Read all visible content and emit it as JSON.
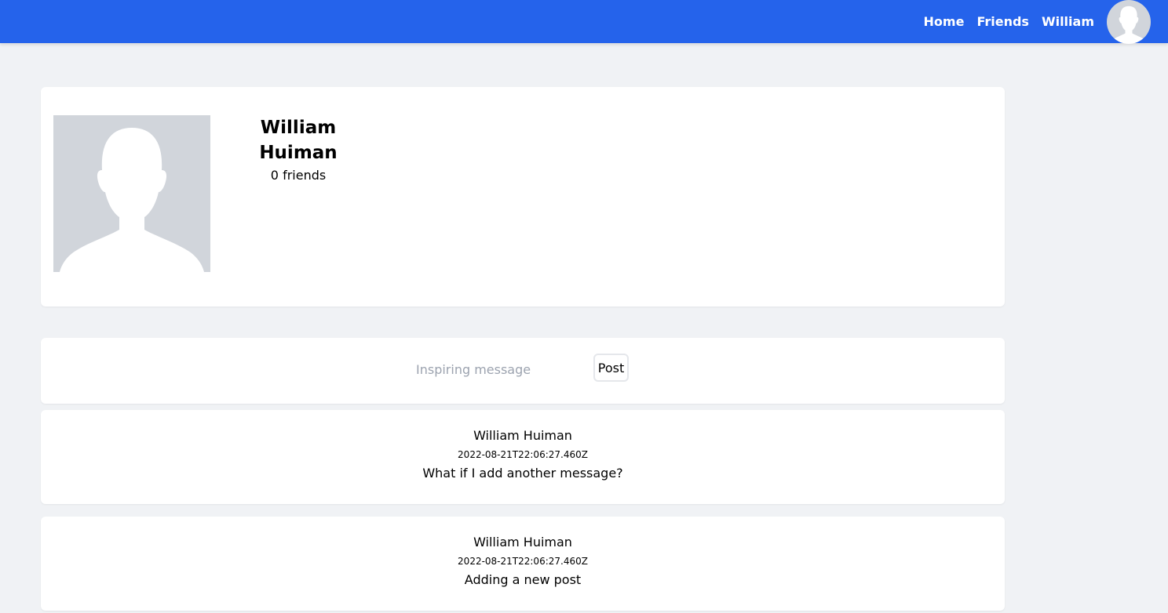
{
  "nav": {
    "links": [
      {
        "label": "Home"
      },
      {
        "label": "Friends"
      },
      {
        "label": "William"
      }
    ],
    "avatar_icon": "user-avatar-icon",
    "background": "#2563eb"
  },
  "profile": {
    "name": "William Huiman",
    "friends_text": "0 friends",
    "photo_icon": "default-user-silhouette-icon"
  },
  "composer": {
    "placeholder": "Inspiring message",
    "post_label": "Post"
  },
  "posts": [
    {
      "author": "William Huiman",
      "timestamp": "2022-08-21T22:06:27.460Z",
      "text": "What if I add another message?"
    },
    {
      "author": "William Huiman",
      "timestamp": "2022-08-21T22:06:27.460Z",
      "text": "Adding a new post"
    }
  ]
}
